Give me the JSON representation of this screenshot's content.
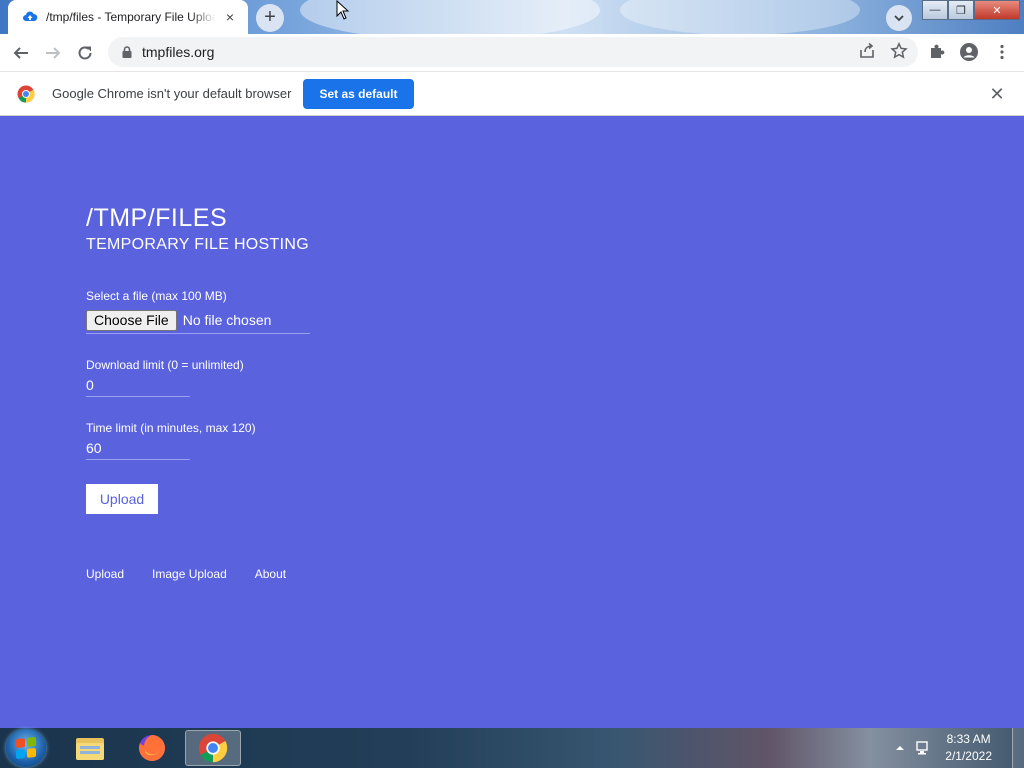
{
  "browser": {
    "tab_title": "/tmp/files - Temporary File Upload",
    "tab_close_icon": "×",
    "new_tab_icon": "+",
    "url": "tmpfiles.org",
    "window_buttons": {
      "minimize": "—",
      "maximize": "❐",
      "close": "✕"
    }
  },
  "infobar": {
    "message": "Google Chrome isn't your default browser",
    "button_label": "Set as default",
    "close_icon": "✕"
  },
  "page": {
    "title": "/TMP/FILES",
    "subtitle": "TEMPORARY FILE HOSTING",
    "file_label": "Select a file (max 100 MB)",
    "file_button": "Choose File",
    "file_status": "No file chosen",
    "download_label": "Download limit (0 = unlimited)",
    "download_value": "0",
    "time_label": "Time limit (in minutes, max 120)",
    "time_value": "60",
    "upload_button": "Upload",
    "footer_links": [
      "Upload",
      "Image Upload",
      "About"
    ]
  },
  "taskbar": {
    "time": "8:33 AM",
    "date": "2/1/2022",
    "apps": [
      "file-explorer",
      "firefox",
      "chrome"
    ]
  },
  "colors": {
    "page_background": "#5a62de",
    "chrome_blue": "#1a73e8"
  }
}
